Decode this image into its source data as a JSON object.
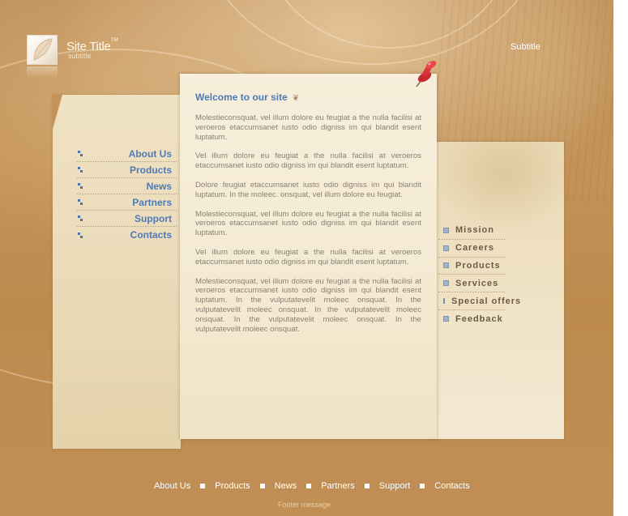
{
  "header": {
    "site_title": "Site Title",
    "trademark": "TM",
    "site_subtitle": "subtitle",
    "subtitle": "Subtitle"
  },
  "left_nav": [
    {
      "label": "About Us"
    },
    {
      "label": "Products"
    },
    {
      "label": "News"
    },
    {
      "label": "Partners"
    },
    {
      "label": "Support"
    },
    {
      "label": "Contacts"
    }
  ],
  "content": {
    "title": "Welcome to our site",
    "paragraphs": [
      "Molestieconsquat, vel illum dolore eu feugiat a the nulla facilisi at veroeros etaccumsanet iusto odio digniss im qui blandit esent luptatum.",
      "Vel illum dolore eu feugiat a the nulla facilisi at veroeros etaccumsanet iusto odio digniss im qui blandit esent luptatum.",
      "Dolore feugiat    etaccumsanet iusto odio digniss im qui blandit luptatum. In the moleec. onsquat, vel illum dolore eu feugiat.",
      "Molestieconsquat, vel illum dolore eu feugiat a the nulla facilisi at veroeros etaccumsanet iusto odio digniss im qui blandit esent luptatum.",
      "Vel illum dolore eu feugiat a the nulla facilisi at veroeros etaccumsanet iusto odio digniss im qui blandit esent luptatum.",
      "Molestieconsquat, vel illum dolore eu feugiat a the nulla facilisi at veroeros etaccumsanet iusto odio digniss im qui blandit esent luptatum. In the vulputatevelit moleec onsquat. In the vulputatevelit moleec onsquat. In the vulputatevelit moleec onsquat. In the vulputatevelit moleec onsquat. In the vulputatevelit moleec onsquat."
    ]
  },
  "right_nav": [
    {
      "label": "Mission"
    },
    {
      "label": "Careers"
    },
    {
      "label": "Products"
    },
    {
      "label": "Services"
    },
    {
      "label": "Special offers"
    },
    {
      "label": "Feedback"
    }
  ],
  "footer": {
    "links": [
      {
        "label": "About Us"
      },
      {
        "label": "Products"
      },
      {
        "label": "News"
      },
      {
        "label": "Partners"
      },
      {
        "label": "Support"
      },
      {
        "label": "Contacts"
      }
    ],
    "message": "Footer message"
  },
  "icons": {
    "logo": "leaf-logo-icon",
    "pin": "push-pin-icon",
    "heart": "heart-icon",
    "left_bullet": "dots-bullet-icon",
    "right_bullet": "square-bullet-icon"
  },
  "colors": {
    "background": "#c39359",
    "panel": "#efe2c3",
    "link_blue": "#4e7ab8",
    "body_text": "#8a7f75",
    "pin_red": "#d8343b"
  }
}
